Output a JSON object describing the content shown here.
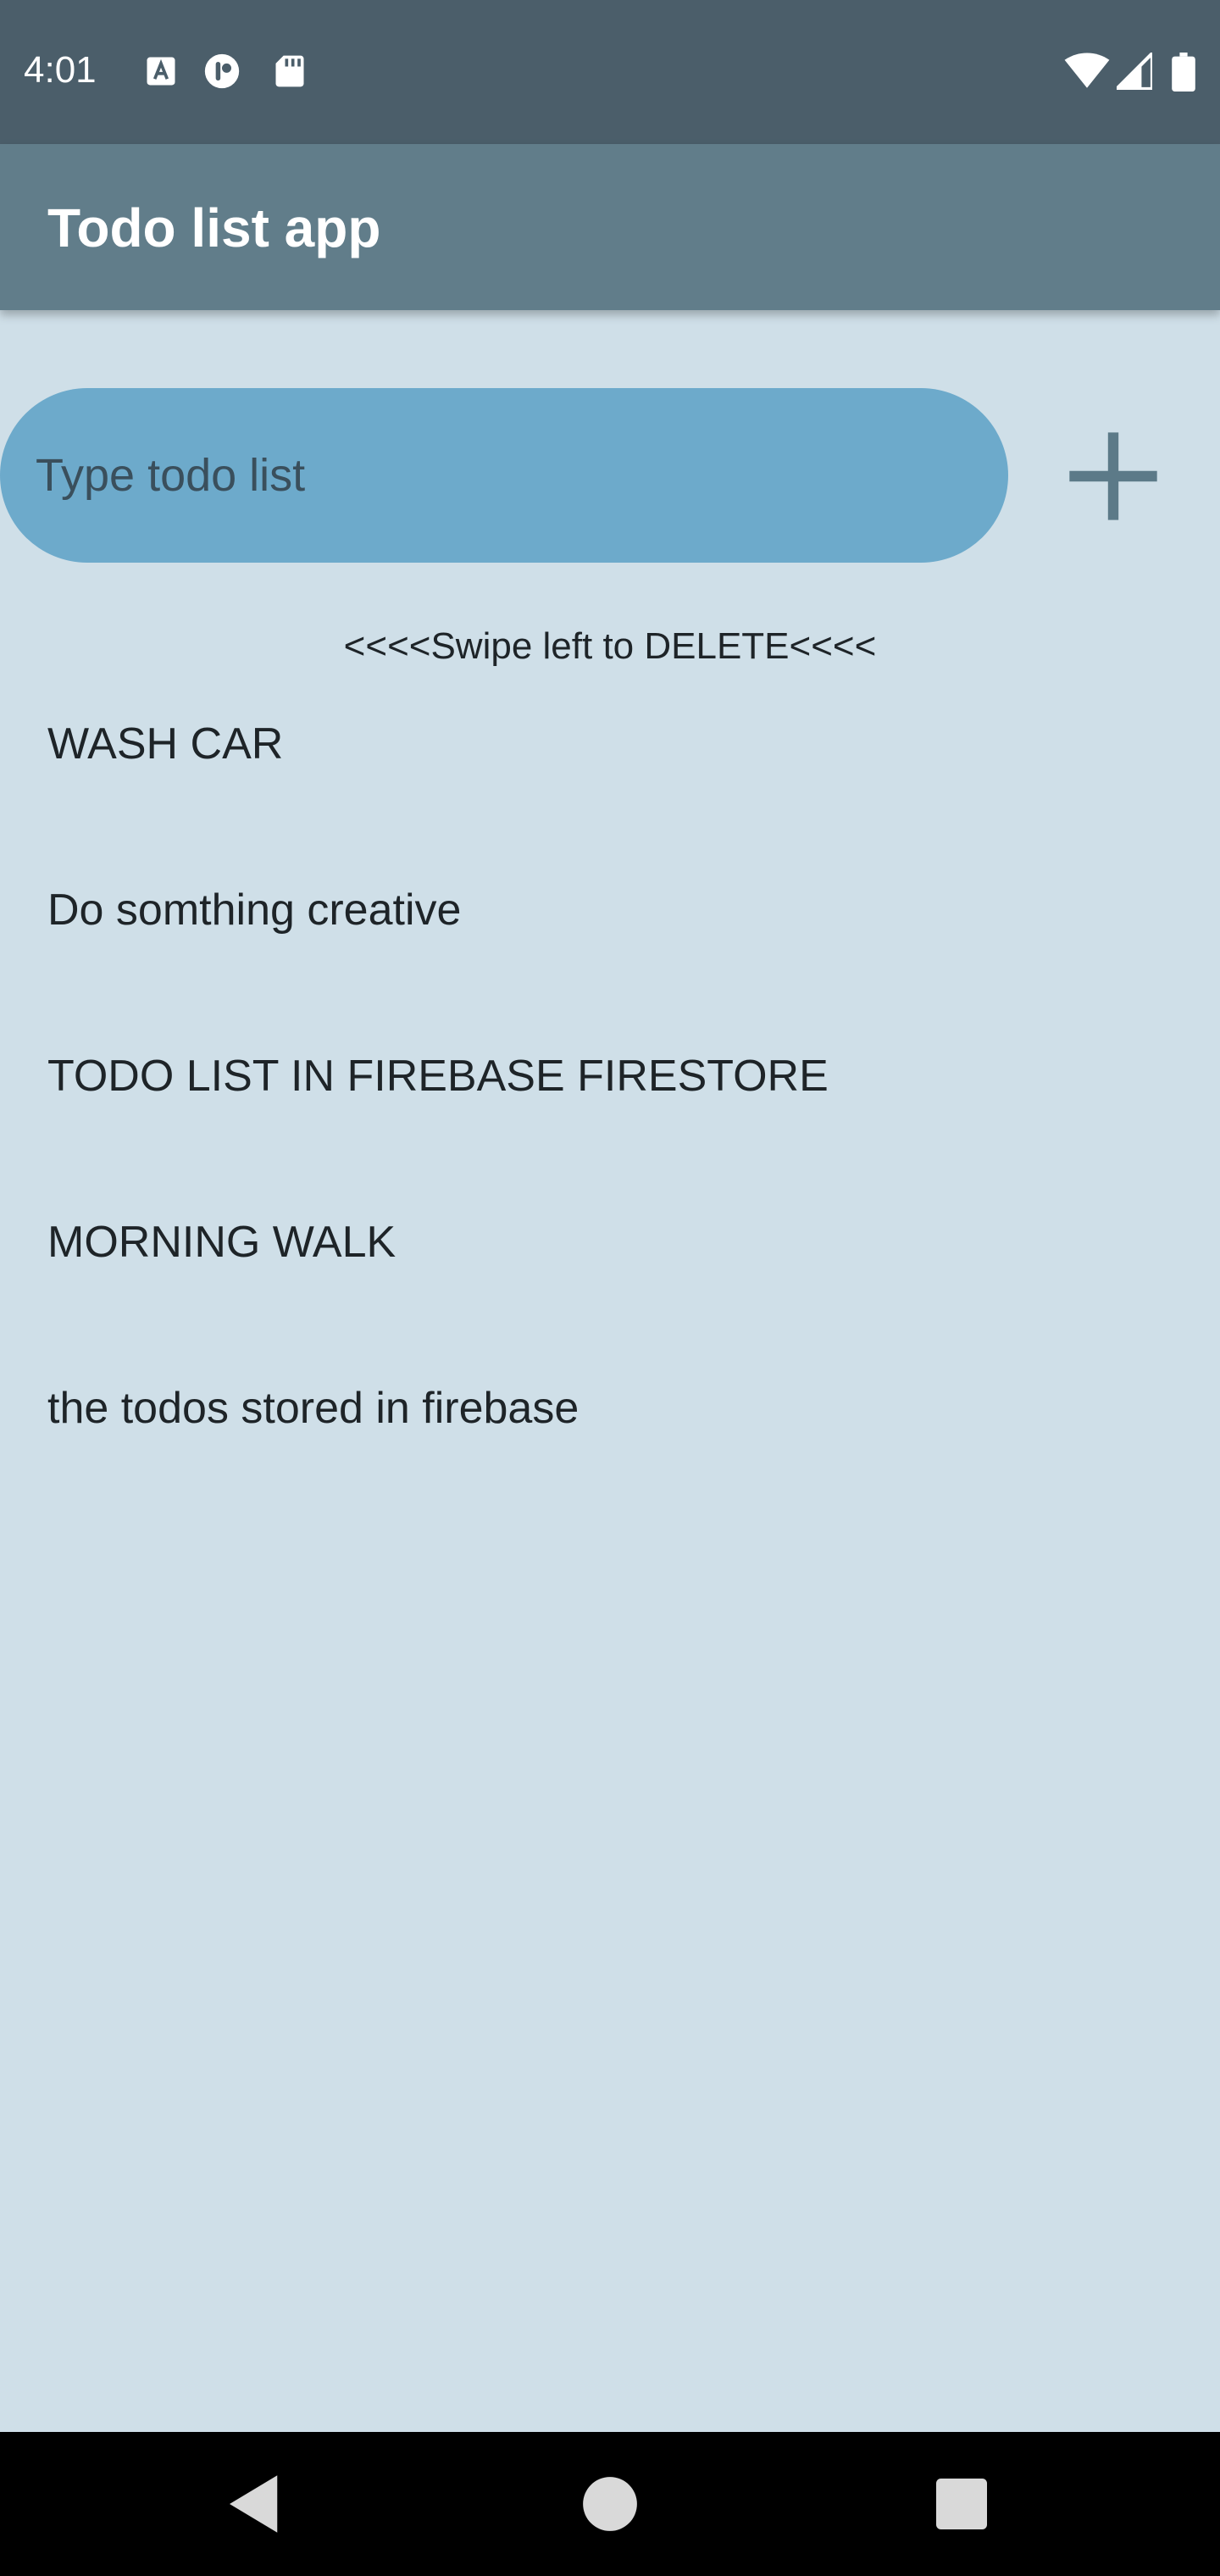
{
  "status_bar": {
    "time": "4:01",
    "icons": [
      "font-a-icon",
      "face-icon",
      "sd-card-icon",
      "wifi-icon",
      "cellular-icon",
      "battery-icon"
    ]
  },
  "app_bar": {
    "title": "Todo list app"
  },
  "input": {
    "placeholder": "Type todo list",
    "value": ""
  },
  "add_button": {
    "icon": "plus-icon"
  },
  "hint": "<<<<Swipe left to DELETE<<<<",
  "todos": [
    "WASH CAR",
    "Do somthing creative",
    "TODO LIST IN FIREBASE FIRESTORE",
    "MORNING WALK",
    "the todos stored in firebase"
  ],
  "nav_bar": {
    "buttons": [
      "back-icon",
      "home-icon",
      "recents-icon"
    ]
  },
  "colors": {
    "background": "#cfdfe8",
    "status_bar": "#4b5e6a",
    "app_bar": "#617d8a",
    "input_fill": "#6daacb",
    "plus_icon": "#5c7a88",
    "nav_bar": "#000000"
  }
}
